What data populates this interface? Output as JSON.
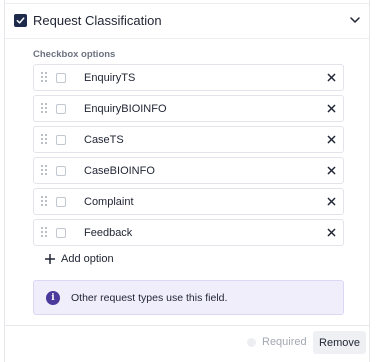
{
  "header": {
    "title": "Request Classification",
    "checked": true
  },
  "section": {
    "label": "Checkbox options"
  },
  "options": [
    {
      "label": "EnquiryTS"
    },
    {
      "label": "EnquiryBIOINFO"
    },
    {
      "label": "CaseTS"
    },
    {
      "label": "CaseBIOINFO"
    },
    {
      "label": "Complaint"
    },
    {
      "label": "Feedback"
    }
  ],
  "add_option": {
    "label": "Add option"
  },
  "info": {
    "text": "Other request types use this field.",
    "icon": "info-icon",
    "color": "#4b3a9c",
    "background": "#f1eefc"
  },
  "footer": {
    "required_label": "Required",
    "remove_label": "Remove"
  },
  "colors": {
    "checkbox_fill": "#1e2a4a",
    "text": "#1f2433",
    "muted": "#a3a8b2"
  }
}
